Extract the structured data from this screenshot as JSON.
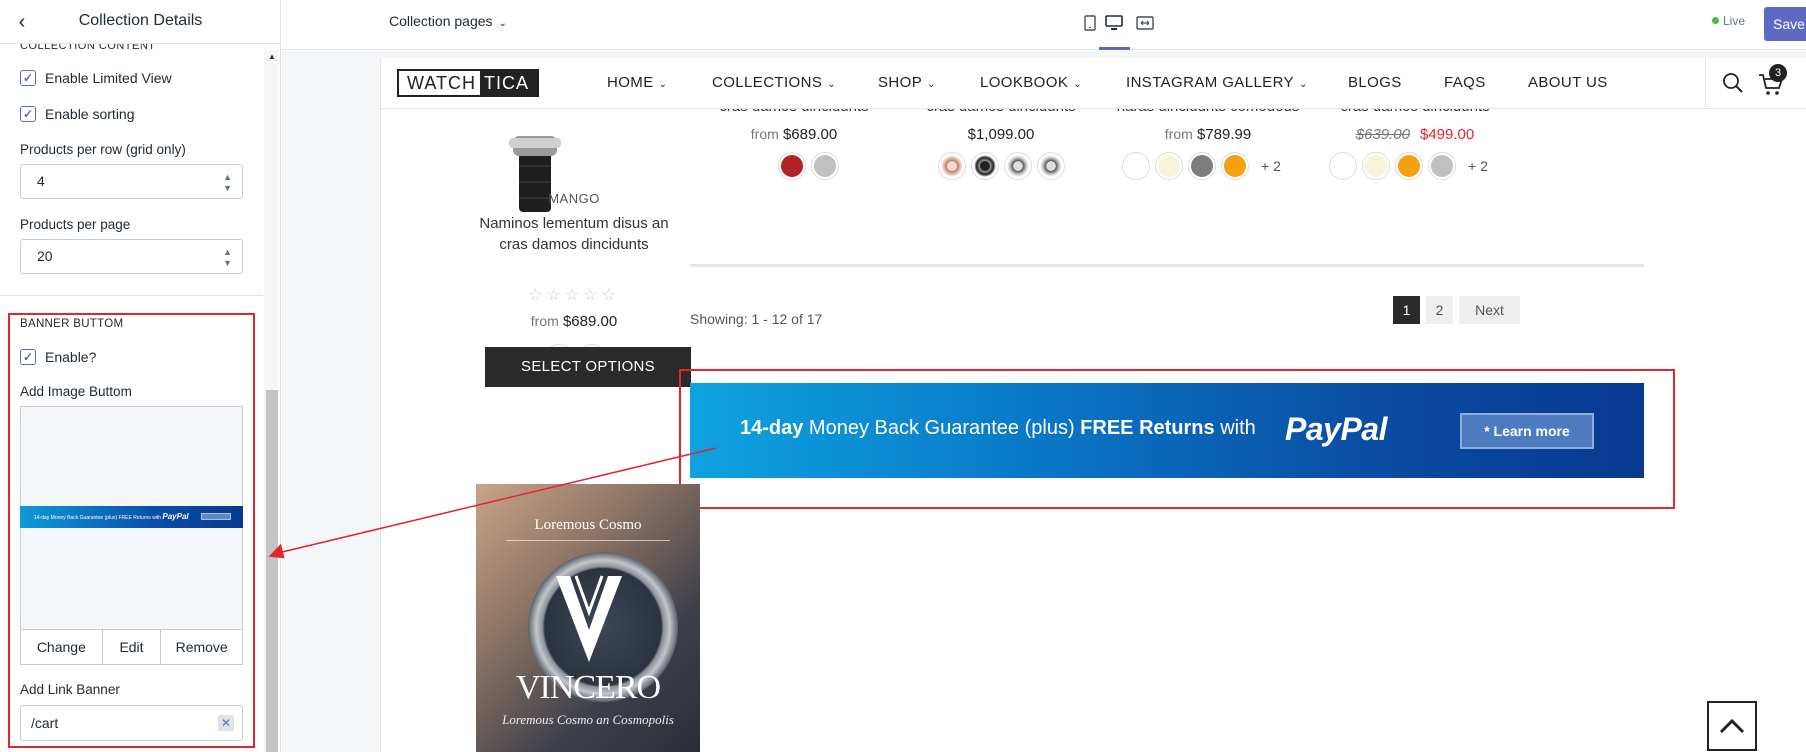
{
  "sidebar": {
    "title": "Collection Details",
    "cut_heading": "COLLECTION CONTENT",
    "enable_limited_view": "Enable Limited View",
    "enable_sorting": "Enable sorting",
    "per_row_label": "Products per row (grid only)",
    "per_row_value": "4",
    "per_page_label": "Products per page",
    "per_page_value": "20",
    "banner_section": "BANNER BUTTOM",
    "enable_label": "Enable?",
    "add_image_label": "Add Image Buttom",
    "thumb_text": "14-day Money Back Guarantee (plus) FREE Returns with",
    "thumb_paypal": "PayPal",
    "change": "Change",
    "edit": "Edit",
    "remove": "Remove",
    "link_label": "Add Link Banner",
    "link_value": "/cart"
  },
  "topbar": {
    "page_select": "Collection pages",
    "live": "Live",
    "save": "Save"
  },
  "store": {
    "logo_a": "WATCH",
    "logo_b": "TICA",
    "nav": [
      {
        "label": "HOME",
        "dropdown": true
      },
      {
        "label": "COLLECTIONS",
        "dropdown": true
      },
      {
        "label": "SHOP",
        "dropdown": true
      },
      {
        "label": "LOOKBOOK",
        "dropdown": true
      },
      {
        "label": "INSTAGRAM GALLERY",
        "dropdown": true
      },
      {
        "label": "BLOGS",
        "dropdown": false
      },
      {
        "label": "FAQS",
        "dropdown": false
      },
      {
        "label": "ABOUT US",
        "dropdown": false
      }
    ],
    "cart_count": "3",
    "products_top": [
      {
        "title": "cras damos dincidunts",
        "from": "from",
        "price": "$689.00"
      },
      {
        "title": "cras damos dincidunts",
        "price": "$1,099.00"
      },
      {
        "title": "haras dincidunts comodous",
        "from": "from",
        "price": "$789.99"
      },
      {
        "title": "cras damos dincidunts",
        "old_price": "$639.00",
        "price": "$499.00"
      }
    ],
    "swatch_colors": {
      "red": "#b22222",
      "grey": "#c0c0c0",
      "white": "#ffffff",
      "cream": "#f7f4d9",
      "dark_grey": "#7d7d7d",
      "orange": "#f5a00f"
    },
    "plus_more": "+ 2",
    "left_product": {
      "vendor": "MANGO",
      "title": "Naminos lementum disus an cras damos dincidunts",
      "stars": "☆☆☆☆☆",
      "from": "from",
      "price": "$689.00",
      "button": "SELECT OPTIONS"
    },
    "showing": "Showing: 1 - 12 of 17",
    "pages": [
      "1",
      "2"
    ],
    "next": "Next",
    "banner": {
      "days": "14-day",
      "mid": " Money Back Guarantee (plus) ",
      "free": "FREE Returns",
      "with": " with",
      "paypal": "PayPal",
      "button": "* Learn more"
    },
    "promo": {
      "top": "Loremous Cosmo",
      "name": "VINCERO",
      "sub": "Loremous Cosmo an Cosmopolis"
    }
  }
}
